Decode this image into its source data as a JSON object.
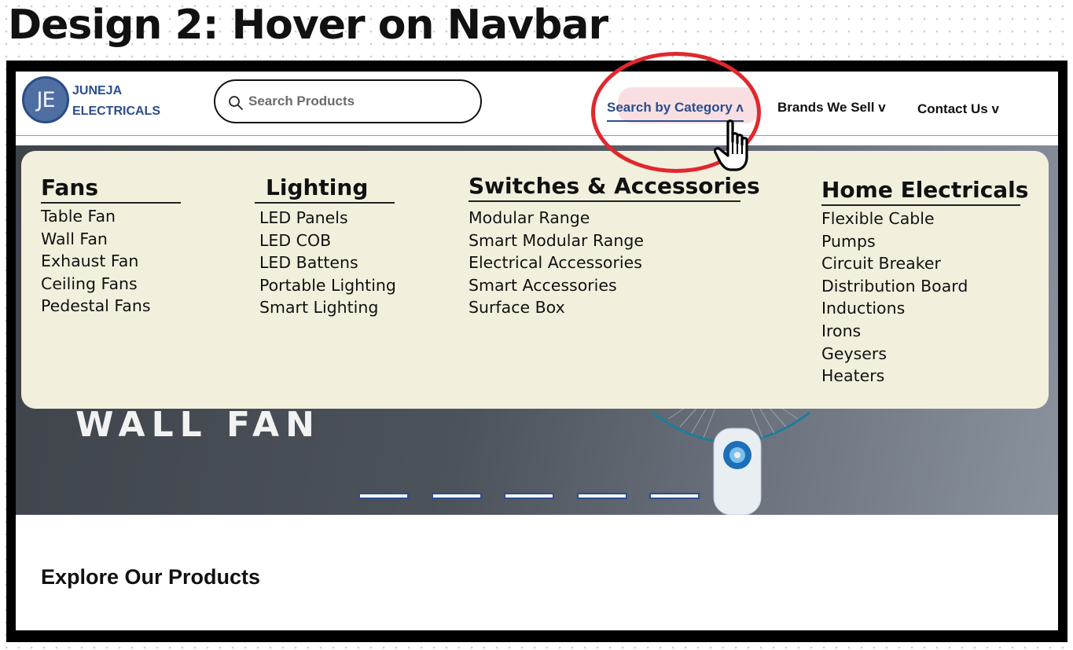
{
  "page_title": "Design 2: Hover on Navbar",
  "navbar": {
    "logo_initials": "JE",
    "brand_line1": "JUNEJA",
    "brand_line2": "ELECTRICALS",
    "search_placeholder": "Search Products",
    "nav_items": [
      {
        "label": "Search by Category",
        "caret": "ʌ",
        "active": true
      },
      {
        "label": "Brands We Sell",
        "caret": "v"
      },
      {
        "label": "Contact Us",
        "caret": "v"
      }
    ]
  },
  "hero": {
    "text": "WALL FAN",
    "carousel_dots": 5
  },
  "mega_menu": {
    "columns": [
      {
        "heading": "Fans",
        "items": [
          "Table Fan",
          "Wall Fan",
          "Exhaust Fan",
          "Ceiling Fans",
          "Pedestal Fans"
        ]
      },
      {
        "heading": "Lighting",
        "items": [
          "LED Panels",
          "LED COB",
          "LED Battens",
          "Portable Lighting",
          "Smart Lighting"
        ]
      },
      {
        "heading": "Switches & Accessories",
        "items": [
          "Modular Range",
          "Smart Modular Range",
          "Electrical Accessories",
          "Smart Accessories",
          "Surface Box"
        ]
      },
      {
        "heading": "Home Electricals",
        "items": [
          "Flexible Cable",
          "Pumps",
          "Circuit Breaker",
          "Distribution Board",
          "Inductions",
          "Irons",
          "Geysers",
          "Heaters"
        ]
      }
    ]
  },
  "explore_heading": "Explore Our Products",
  "colors": {
    "brand_blue": "#2b4e8c",
    "menu_bg": "#f2f0dd",
    "annotation_red": "#e0282e"
  },
  "icons": {
    "search": "search-icon",
    "cursor": "hand-pointer-icon"
  }
}
